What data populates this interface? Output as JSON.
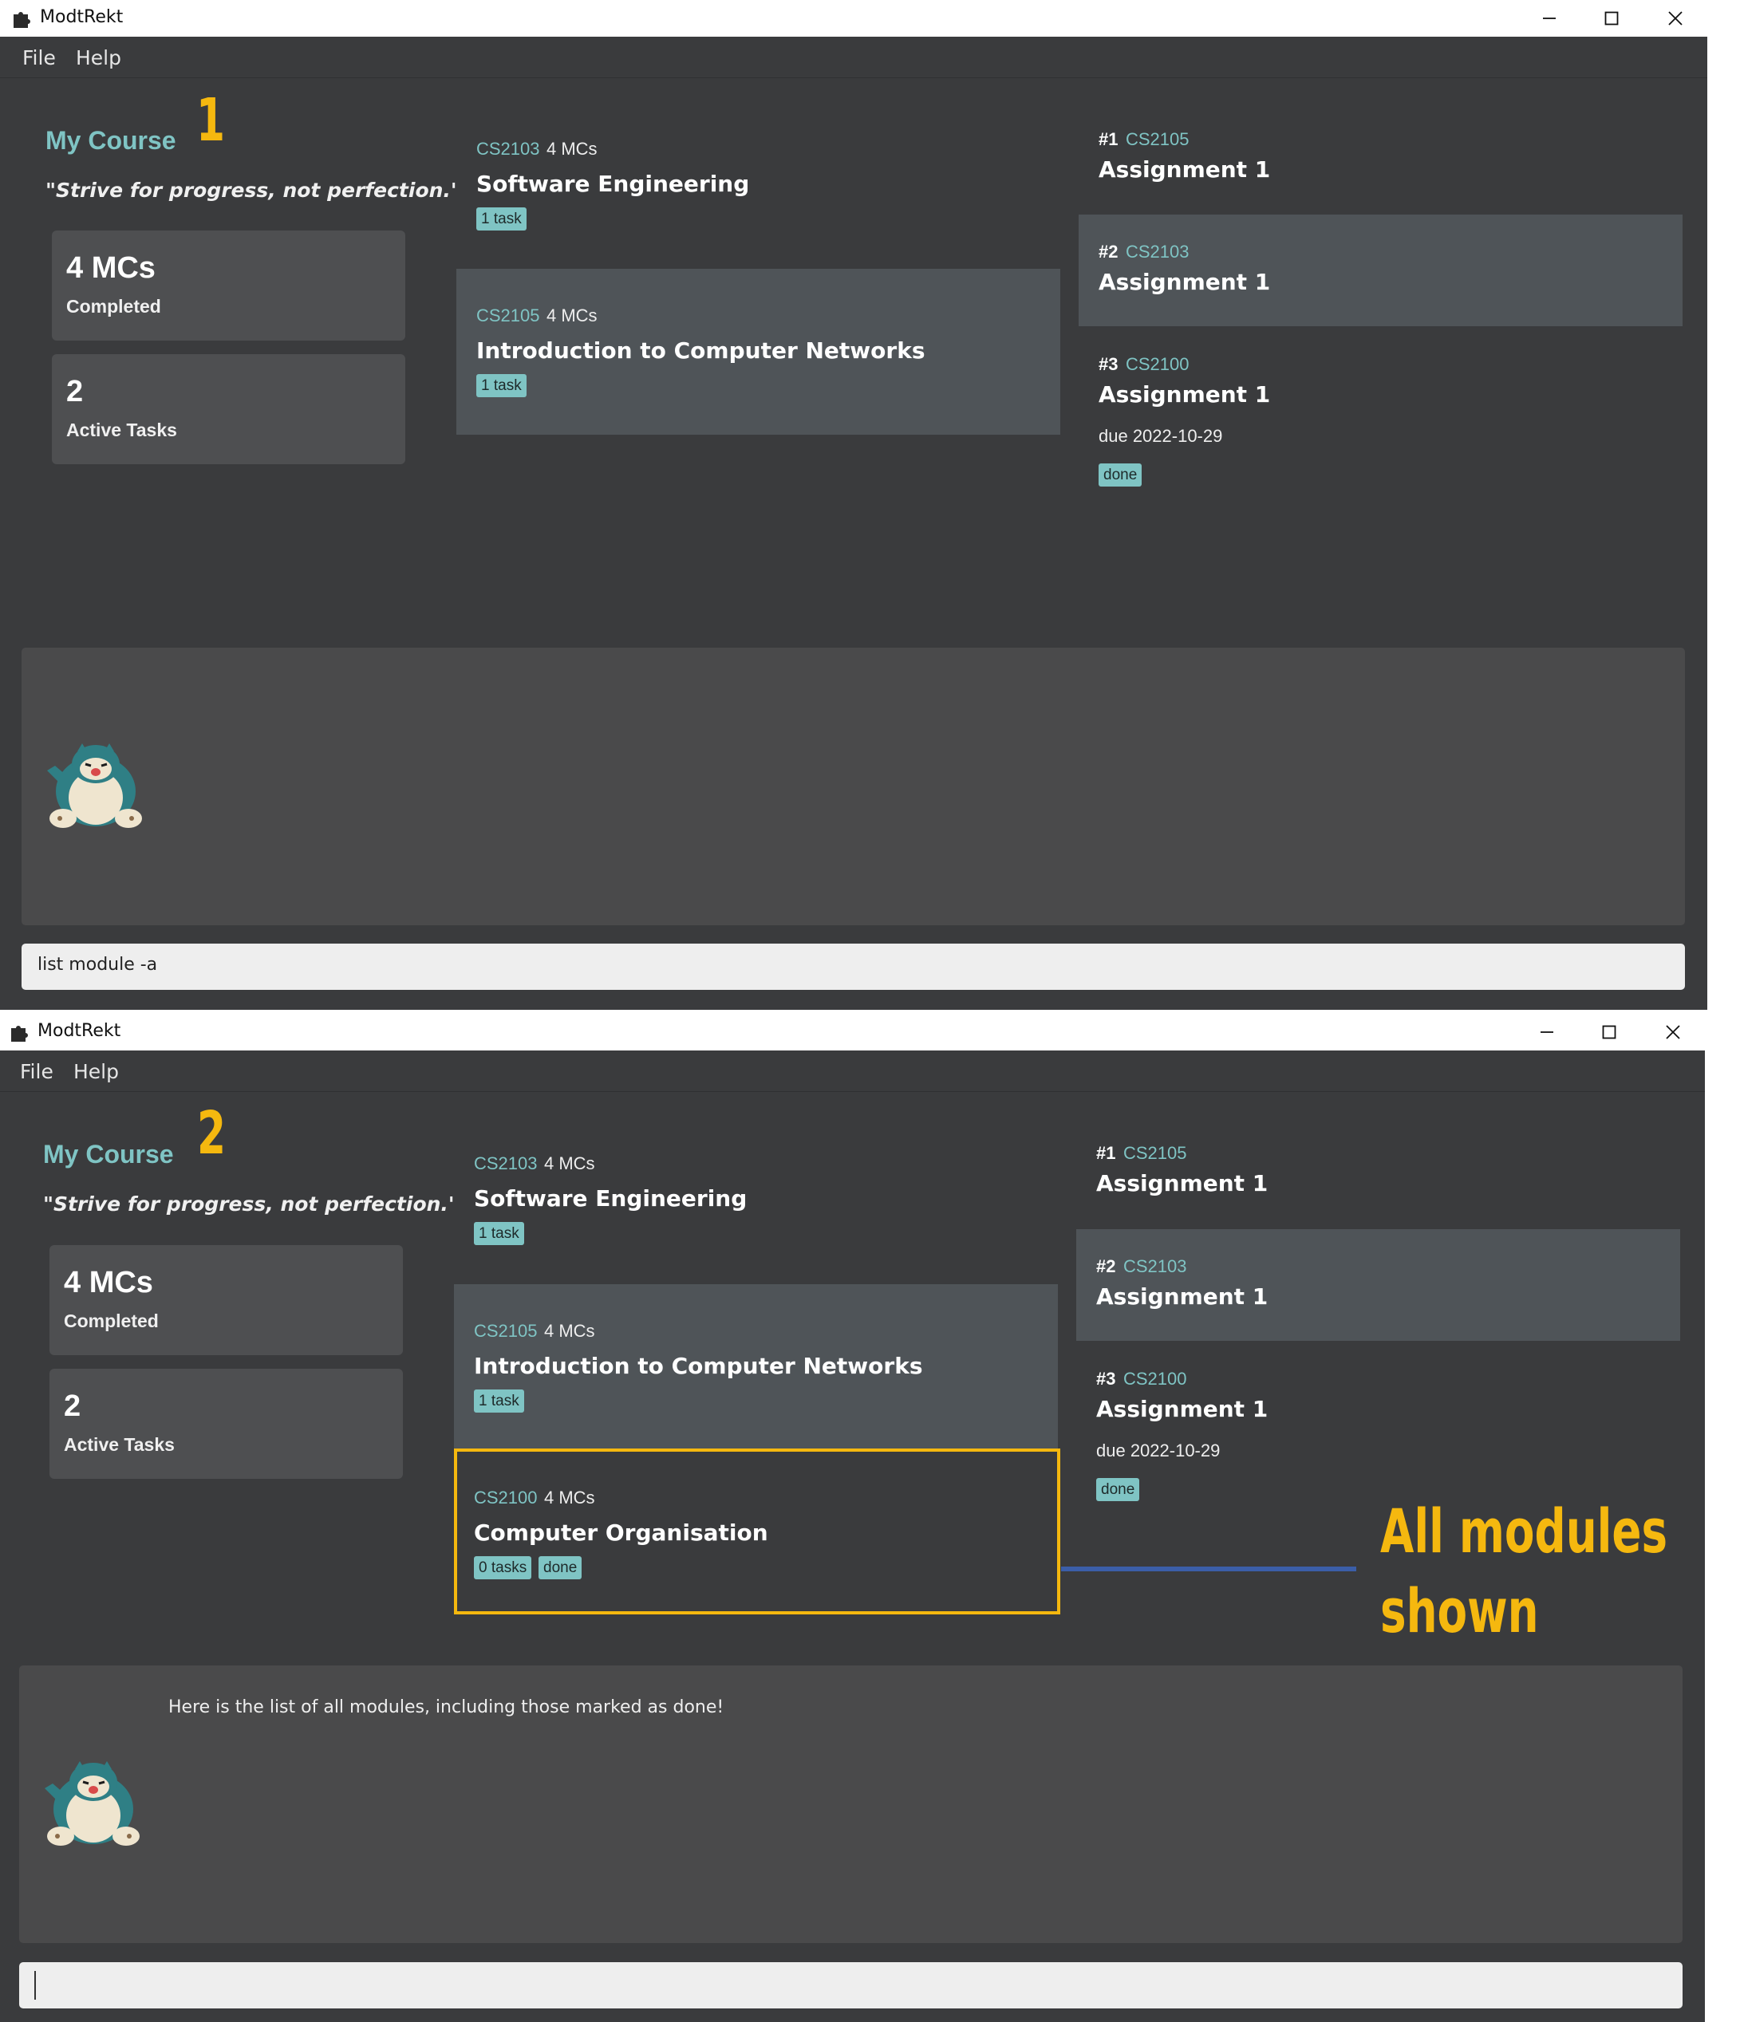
{
  "windows": [
    {
      "title": "ModtRekt",
      "menu": [
        "File",
        "Help"
      ],
      "step": "1",
      "course": {
        "title": "My Course",
        "quote": "\"Strive for progress, not perfection.\""
      },
      "stats": [
        {
          "value": "4 MCs",
          "label": "Completed"
        },
        {
          "value": "2",
          "label": "Active Tasks"
        }
      ],
      "modules": [
        {
          "code": "CS2103",
          "mcs": "4 MCs",
          "name": "Software Engineering",
          "tags": [
            "1 task"
          ]
        },
        {
          "code": "CS2105",
          "mcs": "4 MCs",
          "name": "Introduction to Computer Networks",
          "tags": [
            "1 task"
          ]
        }
      ],
      "tasks": [
        {
          "num": "#1",
          "module": "CS2105",
          "name": "Assignment 1"
        },
        {
          "num": "#2",
          "module": "CS2103",
          "name": "Assignment 1"
        },
        {
          "num": "#3",
          "module": "CS2100",
          "name": "Assignment 1",
          "due": "due 2022-10-29",
          "tag": "done"
        }
      ],
      "result": "",
      "command": "list module -a"
    },
    {
      "title": "ModtRekt",
      "menu": [
        "File",
        "Help"
      ],
      "step": "2",
      "course": {
        "title": "My Course",
        "quote": "\"Strive for progress, not perfection.\""
      },
      "stats": [
        {
          "value": "4 MCs",
          "label": "Completed"
        },
        {
          "value": "2",
          "label": "Active Tasks"
        }
      ],
      "modules": [
        {
          "code": "CS2103",
          "mcs": "4 MCs",
          "name": "Software Engineering",
          "tags": [
            "1 task"
          ]
        },
        {
          "code": "CS2105",
          "mcs": "4 MCs",
          "name": "Introduction to Computer Networks",
          "tags": [
            "1 task"
          ]
        },
        {
          "code": "CS2100",
          "mcs": "4 MCs",
          "name": "Computer Organisation",
          "tags": [
            "0 tasks",
            "done"
          ]
        }
      ],
      "tasks": [
        {
          "num": "#1",
          "module": "CS2105",
          "name": "Assignment 1"
        },
        {
          "num": "#2",
          "module": "CS2103",
          "name": "Assignment 1"
        },
        {
          "num": "#3",
          "module": "CS2100",
          "name": "Assignment 1",
          "due": "due 2022-10-29",
          "tag": "done"
        }
      ],
      "result": "Here is the list of all modules, including those marked as done!",
      "command": ""
    }
  ],
  "annotation": {
    "line1": "All modules",
    "line2": "shown"
  },
  "colors": {
    "accent": "#7fc4c4",
    "highlight": "#f5b80f",
    "connector": "#3b5ea8",
    "window_bg": "#3a3b3d"
  },
  "icons": [
    "puzzle-app-icon",
    "minimize-icon",
    "maximize-icon",
    "close-icon",
    "snorlax-mascot"
  ]
}
